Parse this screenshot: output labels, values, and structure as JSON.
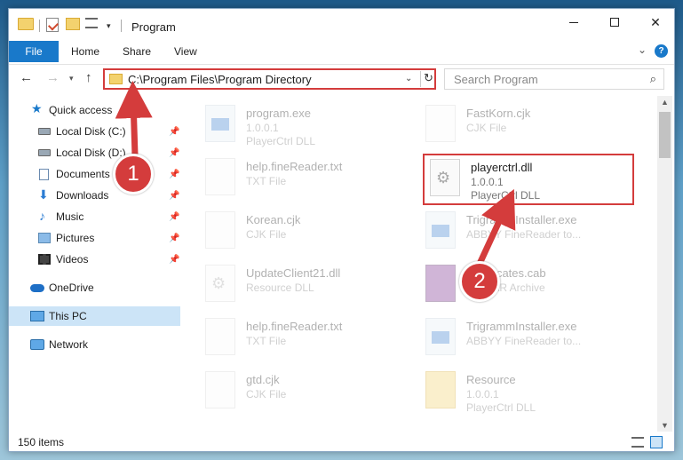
{
  "window": {
    "title": "Program",
    "quick_access_dropdown": "▾",
    "minimize_label": "",
    "maximize_label": "",
    "close_label": "✕"
  },
  "ribbon": {
    "tabs": [
      "File",
      "Home",
      "Share",
      "View"
    ],
    "help": "?",
    "collapse": "⌄"
  },
  "nav": {
    "back": "←",
    "forward": "→",
    "recent": "▾",
    "up": "↑",
    "address": "C:\\Program Files\\Program Directory",
    "address_dropdown": "⌄",
    "refresh": "↻",
    "search_placeholder": "Search Program",
    "search_icon": "⌕"
  },
  "sidebar": {
    "items": [
      {
        "label": "Quick access",
        "icon": "star-icon",
        "pinned": false
      },
      {
        "label": "Local Disk (C:)",
        "icon": "disk-icon",
        "pinned": true
      },
      {
        "label": "Local Disk (D:)",
        "icon": "disk-icon",
        "pinned": true
      },
      {
        "label": "Documents",
        "icon": "documents-icon",
        "pinned": true
      },
      {
        "label": "Downloads",
        "icon": "downloads-icon",
        "pinned": true
      },
      {
        "label": "Music",
        "icon": "music-icon",
        "pinned": true
      },
      {
        "label": "Pictures",
        "icon": "pictures-icon",
        "pinned": true
      },
      {
        "label": "Videos",
        "icon": "videos-icon",
        "pinned": true
      },
      {
        "label": "OneDrive",
        "icon": "onedrive-icon",
        "pinned": false
      },
      {
        "label": "This PC",
        "icon": "this-pc-icon",
        "pinned": false,
        "selected": true
      },
      {
        "label": "Network",
        "icon": "network-icon",
        "pinned": false
      }
    ],
    "pin_glyph": "📌"
  },
  "files": [
    {
      "name": "program.exe",
      "line1": "1.0.0.1",
      "line2": "PlayerCtrl DLL",
      "icon": "exe-icon",
      "faded": true
    },
    {
      "name": "FastKorn.cjk",
      "line1": "CJK File",
      "line2": "",
      "icon": "file-icon",
      "faded": true
    },
    {
      "name": "help.fineReader.txt",
      "line1": "TXT File",
      "line2": "",
      "icon": "file-icon",
      "faded": true
    },
    {
      "name": "playerctrl.dll",
      "line1": "1.0.0.1",
      "line2": "PlayerCtrl DLL",
      "icon": "gear-file-icon",
      "faded": false
    },
    {
      "name": "Korean.cjk",
      "line1": "CJK File",
      "line2": "",
      "icon": "file-icon",
      "faded": true
    },
    {
      "name": "TrigrammInstaller.exe",
      "line1": "ABBYY FineReader to...",
      "line2": "",
      "icon": "exe-icon",
      "faded": true
    },
    {
      "name": "UpdateClient21.dll",
      "line1": "Resource DLL",
      "line2": "",
      "icon": "gear-file-icon",
      "faded": true
    },
    {
      "name": "Certificates.cab",
      "line1": "WinRAR Archive",
      "line2": "",
      "icon": "archive-icon",
      "faded": true
    },
    {
      "name": "help.fineReader.txt",
      "line1": "TXT File",
      "line2": "",
      "icon": "file-icon",
      "faded": true
    },
    {
      "name": "TrigrammInstaller.exe",
      "line1": "ABBYY FineReader to...",
      "line2": "",
      "icon": "exe-icon",
      "faded": true
    },
    {
      "name": "gtd.cjk",
      "line1": "CJK File",
      "line2": "",
      "icon": "file-icon",
      "faded": true
    },
    {
      "name": "Resource",
      "line1": "1.0.0.1",
      "line2": "PlayerCtrl DLL",
      "icon": "folder-icon",
      "faded": true
    }
  ],
  "status": {
    "items_count": "150 items"
  },
  "annotations": {
    "step1": "1",
    "step2": "2"
  },
  "colors": {
    "accent": "#1979ca",
    "highlight_red": "#d43c3c",
    "selected_bg": "#cce4f7"
  }
}
